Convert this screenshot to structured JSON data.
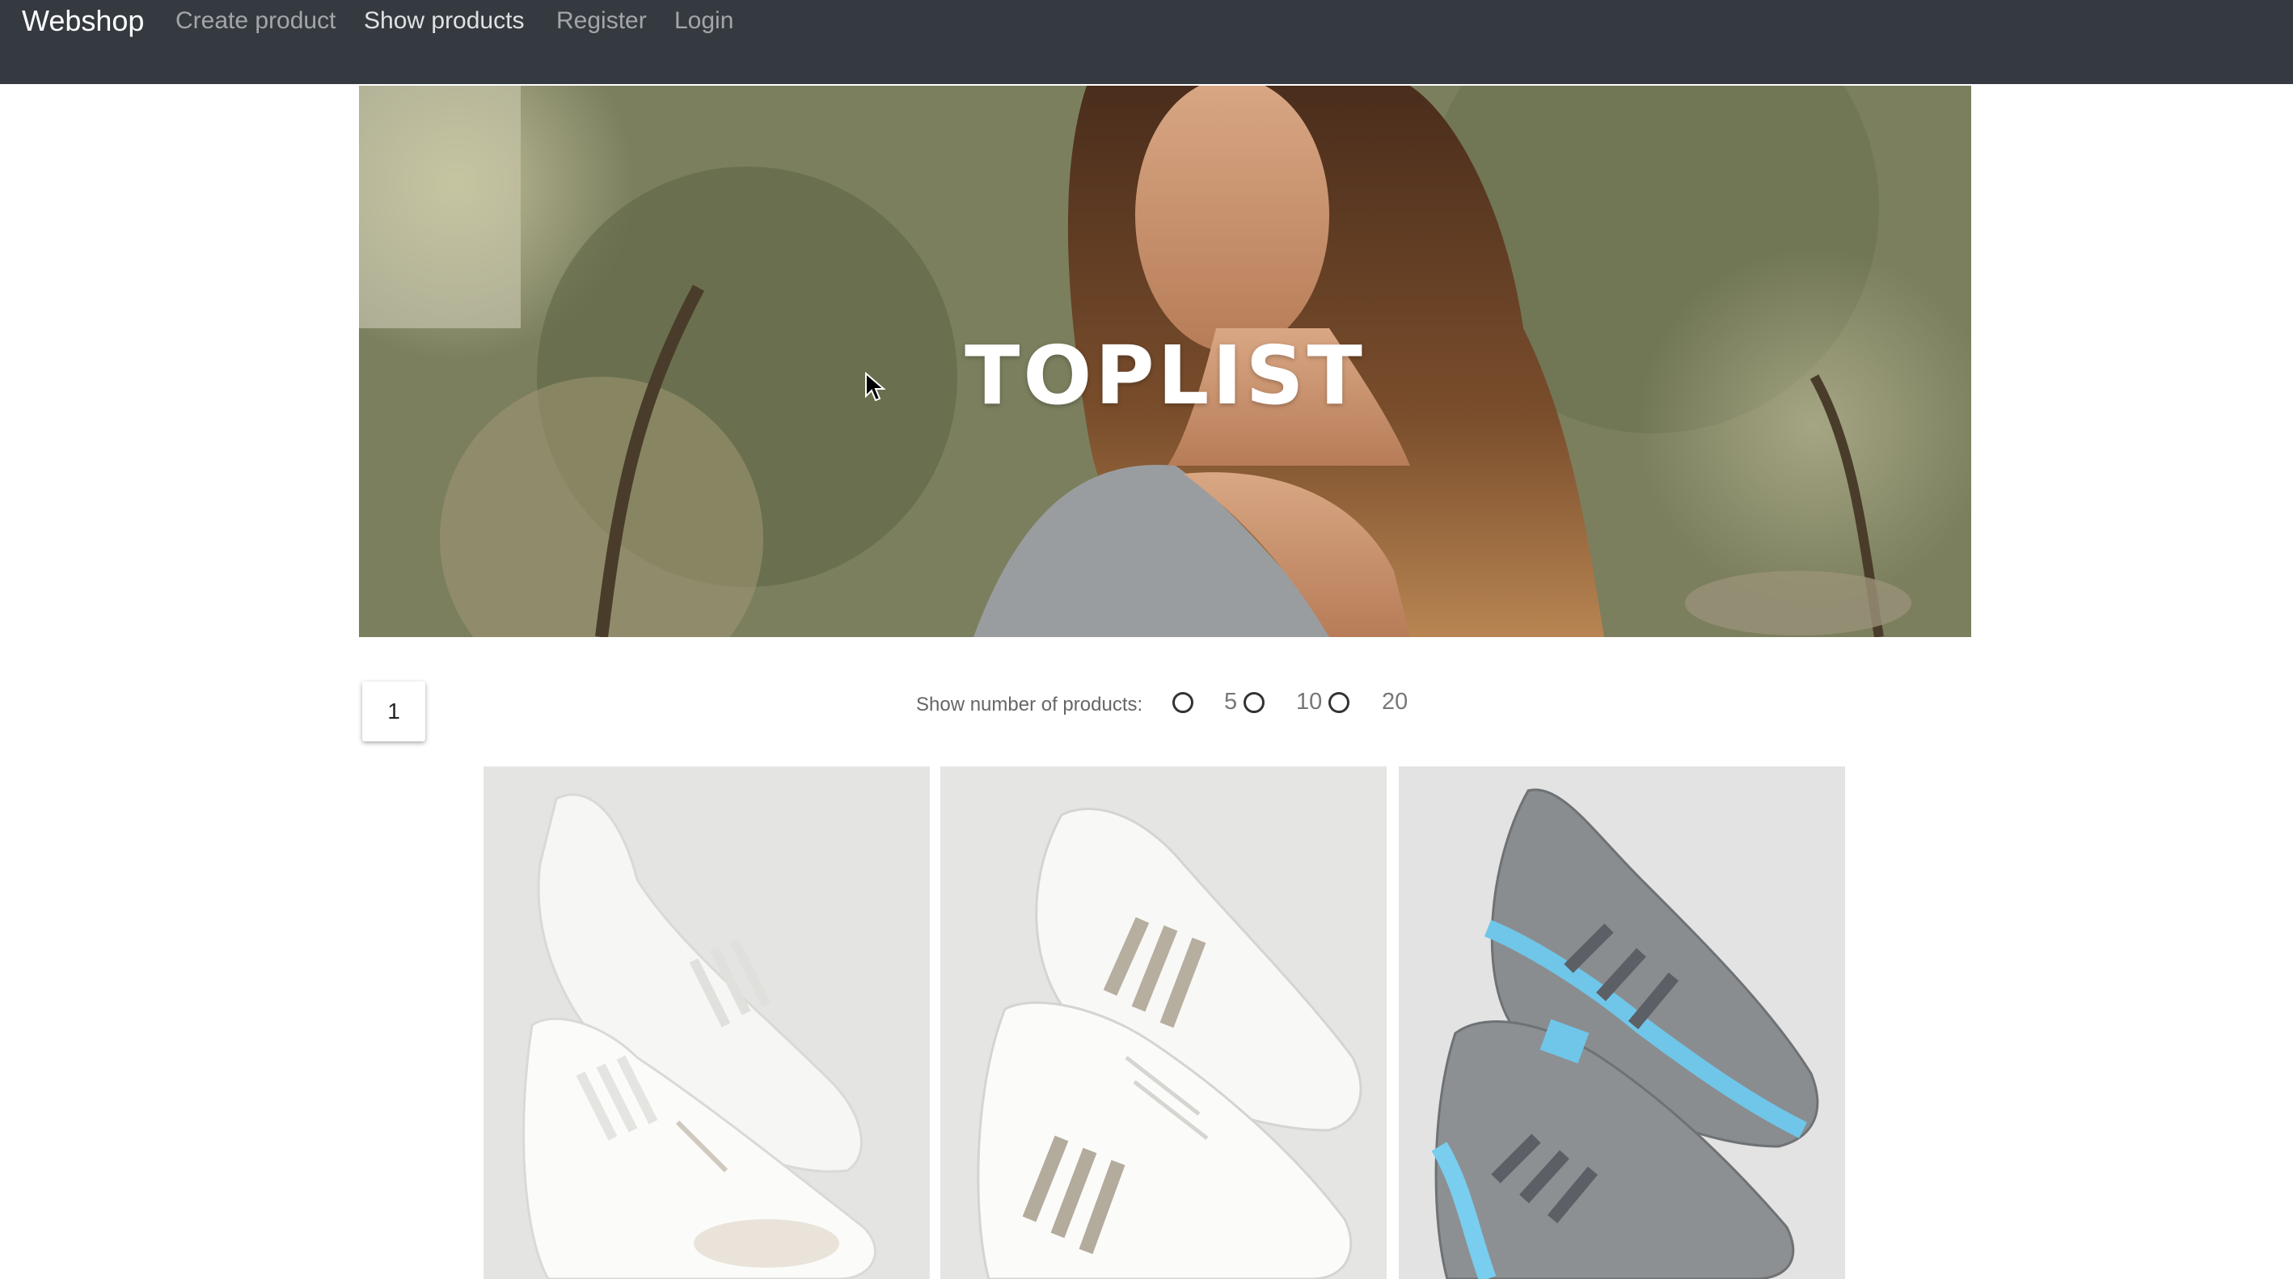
{
  "navbar": {
    "brand": "Webshop",
    "links": [
      {
        "label": "Create product",
        "active": false
      },
      {
        "label": "Show products",
        "active": true
      },
      {
        "label": "Register",
        "active": false
      },
      {
        "label": "Login",
        "active": false
      }
    ]
  },
  "hero": {
    "title": "TOPLIST"
  },
  "pagination": {
    "current_page": "1"
  },
  "product_count": {
    "label": "Show number of products:",
    "options": [
      "5",
      "10",
      "20"
    ]
  },
  "products": [
    {
      "icon": "white-sneakers-image"
    },
    {
      "icon": "white-striped-sneakers-image"
    },
    {
      "icon": "grey-blue-sneakers-image"
    }
  ],
  "colors": {
    "navbar_bg": "#343a40",
    "page_bg": "#ffffff",
    "card_bg": "#e6e7e6"
  }
}
